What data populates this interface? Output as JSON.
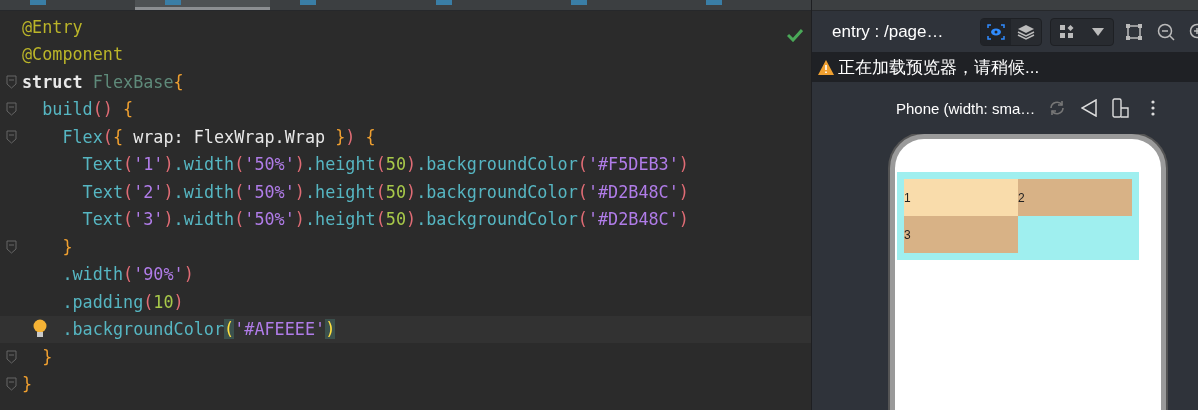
{
  "editor_tabs": [
    {
      "selected": false
    },
    {
      "selected": true
    },
    {
      "selected": false
    },
    {
      "selected": false
    },
    {
      "selected": false
    },
    {
      "selected": false
    }
  ],
  "editor": {
    "checks_passed": true,
    "lines": [
      {
        "fold": false,
        "current": false,
        "tokens": [
          {
            "kind": "annotation",
            "text": "@Entry"
          }
        ]
      },
      {
        "fold": false,
        "current": false,
        "tokens": [
          {
            "kind": "annotation",
            "text": "@Component"
          }
        ]
      },
      {
        "fold": true,
        "current": false,
        "tokens": [
          {
            "kind": "keyword",
            "text": "struct "
          },
          {
            "kind": "type",
            "text": "FlexBase"
          },
          {
            "kind": "brace",
            "text": "{"
          }
        ]
      },
      {
        "fold": true,
        "current": false,
        "tokens": [
          {
            "kind": "func",
            "text": "  build"
          },
          {
            "kind": "paren",
            "text": "()"
          },
          {
            "kind": "brace",
            "text": " {"
          }
        ]
      },
      {
        "fold": true,
        "current": false,
        "tokens": [
          {
            "kind": "func",
            "text": "    Flex"
          },
          {
            "kind": "paren",
            "text": "("
          },
          {
            "kind": "brace",
            "text": "{"
          },
          {
            "kind": "plain",
            "text": " wrap: FlexWrap.Wrap "
          },
          {
            "kind": "brace",
            "text": "}"
          },
          {
            "kind": "paren",
            "text": ")"
          },
          {
            "kind": "brace",
            "text": " {"
          }
        ]
      },
      {
        "fold": false,
        "current": false,
        "tokens": [
          {
            "kind": "func",
            "text": "      Text"
          },
          {
            "kind": "paren",
            "text": "("
          },
          {
            "kind": "string",
            "text": "'1'"
          },
          {
            "kind": "paren",
            "text": ")"
          },
          {
            "kind": "func",
            "text": ".width"
          },
          {
            "kind": "paren",
            "text": "("
          },
          {
            "kind": "string",
            "text": "'50%'"
          },
          {
            "kind": "paren",
            "text": ")"
          },
          {
            "kind": "func",
            "text": ".height"
          },
          {
            "kind": "paren",
            "text": "("
          },
          {
            "kind": "number",
            "text": "50"
          },
          {
            "kind": "paren",
            "text": ")"
          },
          {
            "kind": "func",
            "text": ".backgroundColor"
          },
          {
            "kind": "paren",
            "text": "("
          },
          {
            "kind": "string",
            "text": "'#F5DEB3'"
          },
          {
            "kind": "paren",
            "text": ")"
          }
        ]
      },
      {
        "fold": false,
        "current": false,
        "tokens": [
          {
            "kind": "func",
            "text": "      Text"
          },
          {
            "kind": "paren",
            "text": "("
          },
          {
            "kind": "string",
            "text": "'2'"
          },
          {
            "kind": "paren",
            "text": ")"
          },
          {
            "kind": "func",
            "text": ".width"
          },
          {
            "kind": "paren",
            "text": "("
          },
          {
            "kind": "string",
            "text": "'50%'"
          },
          {
            "kind": "paren",
            "text": ")"
          },
          {
            "kind": "func",
            "text": ".height"
          },
          {
            "kind": "paren",
            "text": "("
          },
          {
            "kind": "number",
            "text": "50"
          },
          {
            "kind": "paren",
            "text": ")"
          },
          {
            "kind": "func",
            "text": ".backgroundColor"
          },
          {
            "kind": "paren",
            "text": "("
          },
          {
            "kind": "string",
            "text": "'#D2B48C'"
          },
          {
            "kind": "paren",
            "text": ")"
          }
        ]
      },
      {
        "fold": false,
        "current": false,
        "tokens": [
          {
            "kind": "func",
            "text": "      Text"
          },
          {
            "kind": "paren",
            "text": "("
          },
          {
            "kind": "string",
            "text": "'3'"
          },
          {
            "kind": "paren",
            "text": ")"
          },
          {
            "kind": "func",
            "text": ".width"
          },
          {
            "kind": "paren",
            "text": "("
          },
          {
            "kind": "string",
            "text": "'50%'"
          },
          {
            "kind": "paren",
            "text": ")"
          },
          {
            "kind": "func",
            "text": ".height"
          },
          {
            "kind": "paren",
            "text": "("
          },
          {
            "kind": "number",
            "text": "50"
          },
          {
            "kind": "paren",
            "text": ")"
          },
          {
            "kind": "func",
            "text": ".backgroundColor"
          },
          {
            "kind": "paren",
            "text": "("
          },
          {
            "kind": "string",
            "text": "'#D2B48C'"
          },
          {
            "kind": "paren",
            "text": ")"
          }
        ]
      },
      {
        "fold": true,
        "current": false,
        "tokens": [
          {
            "kind": "brace",
            "text": "    }"
          }
        ]
      },
      {
        "fold": false,
        "current": false,
        "tokens": [
          {
            "kind": "func",
            "text": "    .width"
          },
          {
            "kind": "paren",
            "text": "("
          },
          {
            "kind": "string",
            "text": "'90%'"
          },
          {
            "kind": "paren",
            "text": ")"
          }
        ]
      },
      {
        "fold": false,
        "current": false,
        "tokens": [
          {
            "kind": "func",
            "text": "    .padding"
          },
          {
            "kind": "paren",
            "text": "("
          },
          {
            "kind": "number",
            "text": "10"
          },
          {
            "kind": "paren",
            "text": ")"
          }
        ]
      },
      {
        "fold": false,
        "current": true,
        "tokens": [
          {
            "kind": "func",
            "text": "    .backgroundColor"
          },
          {
            "kind": "match",
            "text": "("
          },
          {
            "kind": "string",
            "text": "'#AFEEEE'"
          },
          {
            "kind": "match",
            "text": ")"
          }
        ]
      },
      {
        "fold": true,
        "current": false,
        "tokens": [
          {
            "kind": "brace",
            "text": "  }"
          }
        ]
      },
      {
        "fold": true,
        "current": false,
        "tokens": [
          {
            "kind": "brace",
            "text": "}"
          }
        ]
      }
    ]
  },
  "preview": {
    "title": "entry : /page…",
    "inspect_on": true,
    "warning": "正在加载预览器，请稍候...",
    "device": "Phone (width: sma…",
    "cells": [
      {
        "label": "1",
        "color": "#f9dcab"
      },
      {
        "label": "2",
        "color": "#d8b286"
      },
      {
        "label": "3",
        "color": "#d8b286"
      }
    ]
  }
}
